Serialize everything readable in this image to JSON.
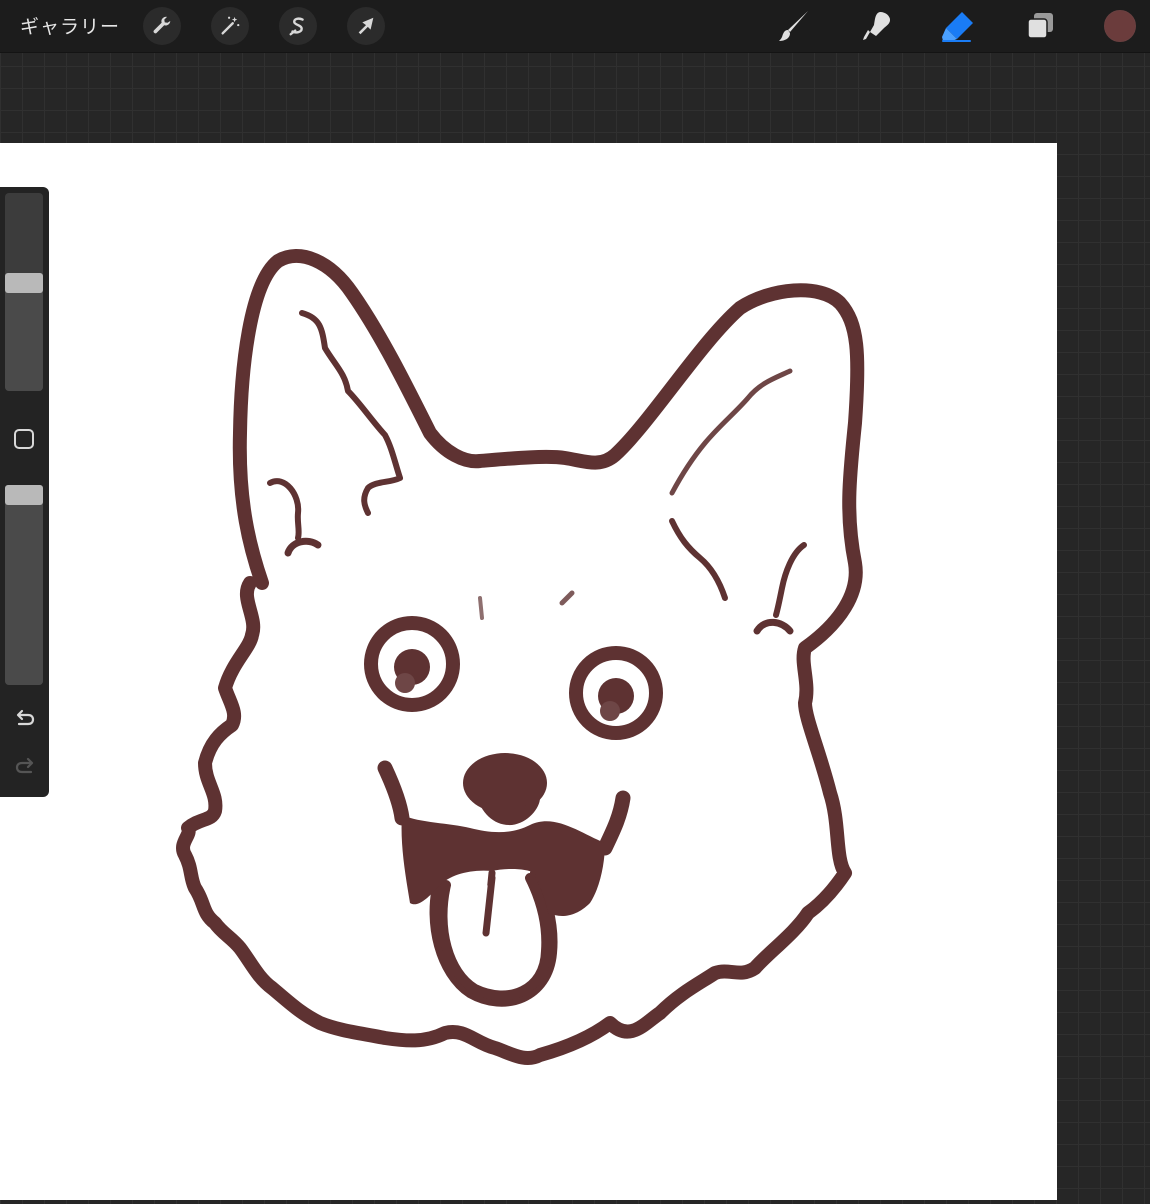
{
  "topbar": {
    "gallery_label": "ギャラリー",
    "actions": [
      {
        "id": "adjust",
        "icon": "wrench-icon"
      },
      {
        "id": "adjustments",
        "icon": "magic-wand-icon"
      },
      {
        "id": "selection",
        "icon": "selection-s-icon"
      },
      {
        "id": "transform",
        "icon": "arrow-cursor-icon"
      }
    ],
    "tools": [
      {
        "id": "brush",
        "icon": "brush-icon",
        "active": false
      },
      {
        "id": "smudge",
        "icon": "smudge-icon",
        "active": false
      },
      {
        "id": "eraser",
        "icon": "eraser-icon",
        "active": true
      },
      {
        "id": "layers",
        "icon": "layers-icon",
        "active": false
      }
    ],
    "current_color": "#6b3c3c"
  },
  "sidebar": {
    "brush_size": 0.55,
    "opacity": 1.0,
    "undo_icon": "undo-icon",
    "redo_icon": "redo-icon"
  },
  "colors": {
    "accent": "#1a7cf5",
    "stroke": "#5e3232"
  },
  "canvas": {
    "drawing": "corgi-sketch"
  }
}
